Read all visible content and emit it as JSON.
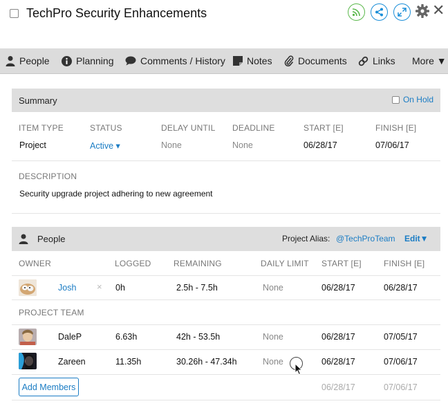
{
  "title": "TechPro Security Enhancements",
  "header_icons": [
    "rss-icon",
    "share-icon",
    "expand-icon",
    "gear-icon",
    "close-icon"
  ],
  "nav": [
    {
      "label": "People",
      "icon": "person-icon"
    },
    {
      "label": "Planning",
      "icon": "info-icon"
    },
    {
      "label": "Comments / History",
      "icon": "comment-icon"
    },
    {
      "label": "Notes",
      "icon": "note-icon"
    },
    {
      "label": "Documents",
      "icon": "paperclip-icon"
    },
    {
      "label": "Links",
      "icon": "link-icon"
    },
    {
      "label": "More ▼",
      "icon": ""
    }
  ],
  "summary": {
    "title": "Summary",
    "on_hold": "On Hold",
    "fields": {
      "item_type": {
        "label": "ITEM TYPE",
        "value": "Project"
      },
      "status": {
        "label": "STATUS",
        "value": "Active ▾"
      },
      "delay_until": {
        "label": "DELAY UNTIL",
        "value": "None"
      },
      "deadline": {
        "label": "DEADLINE",
        "value": "None"
      },
      "start": {
        "label": "START [E]",
        "value": "06/28/17"
      },
      "finish": {
        "label": "FINISH [E]",
        "value": "07/06/17"
      }
    },
    "description_label": "DESCRIPTION",
    "description": "Security upgrade project adhering to new agreement"
  },
  "people": {
    "title": "People",
    "alias_label": "Project Alias:",
    "alias": "@TechProTeam",
    "edit": "Edit▼",
    "columns": {
      "owner": "OWNER",
      "logged": "LOGGED",
      "remaining": "REMAINING",
      "daily_limit": "DAILY LIMIT",
      "start": "START [E]",
      "finish": "FINISH [E]"
    },
    "owner": {
      "name": "Josh",
      "remove": "×",
      "logged": "0h",
      "remaining": "2.5h - 7.5h",
      "daily_limit": "None",
      "start": "06/28/17",
      "finish": "06/28/17"
    },
    "team_label": "PROJECT TEAM",
    "team": [
      {
        "name": "DaleP",
        "logged": "6.63h",
        "remaining": "42h - 53.5h",
        "daily_limit": "None",
        "start": "06/28/17",
        "finish": "07/05/17"
      },
      {
        "name": "Zareen",
        "logged": "11.35h",
        "remaining": "30.26h - 47.34h",
        "daily_limit": "None",
        "start": "06/28/17",
        "finish": "07/06/17"
      }
    ],
    "add_members": "Add Members",
    "totals": {
      "start": "06/28/17",
      "finish": "07/06/17"
    }
  },
  "colors": {
    "accent": "#1a7cc4",
    "rss": "#5ab84b",
    "nav_bg": "#dcdcdc",
    "section_bg": "#dedede"
  }
}
